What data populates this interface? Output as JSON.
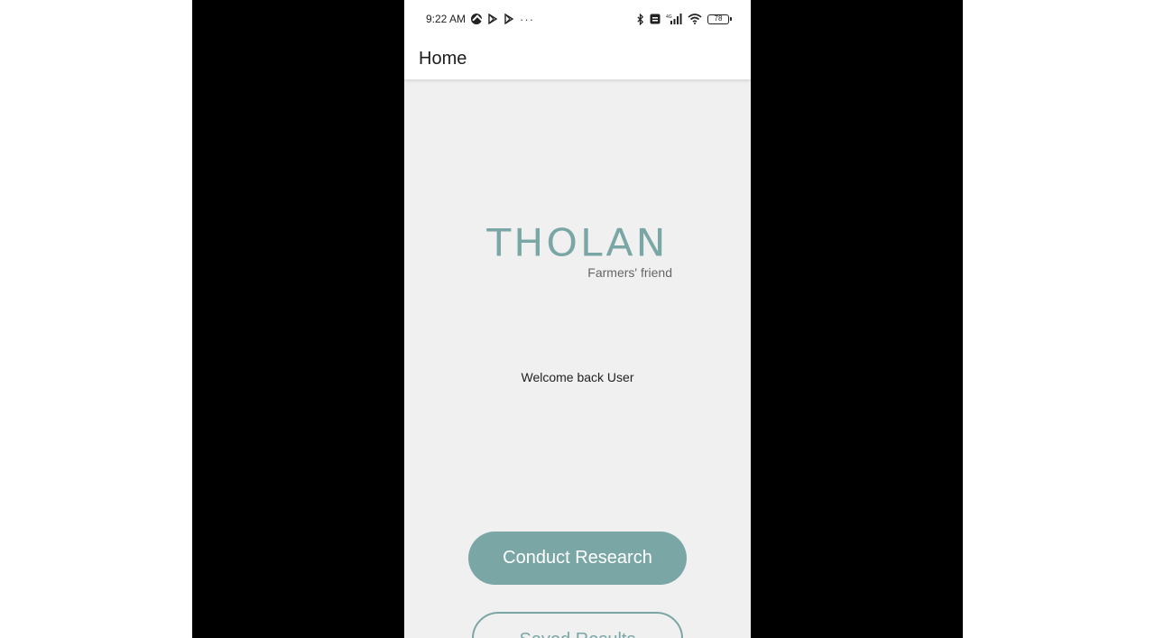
{
  "status_bar": {
    "time": "9:22 AM",
    "battery_level": "78",
    "overflow_indicator": "···"
  },
  "app_bar": {
    "title": "Home"
  },
  "brand": {
    "logo_text": "THOLAN",
    "tagline": "Farmers' friend",
    "color": "#7aa7a5"
  },
  "main": {
    "welcome_text": "Welcome back User"
  },
  "actions": {
    "conduct_research_label": "Conduct Research",
    "saved_results_label": "Saved Results"
  },
  "colors": {
    "accent": "#7aa7a5",
    "background": "#f0f0f0",
    "letterbox": "#000000"
  }
}
